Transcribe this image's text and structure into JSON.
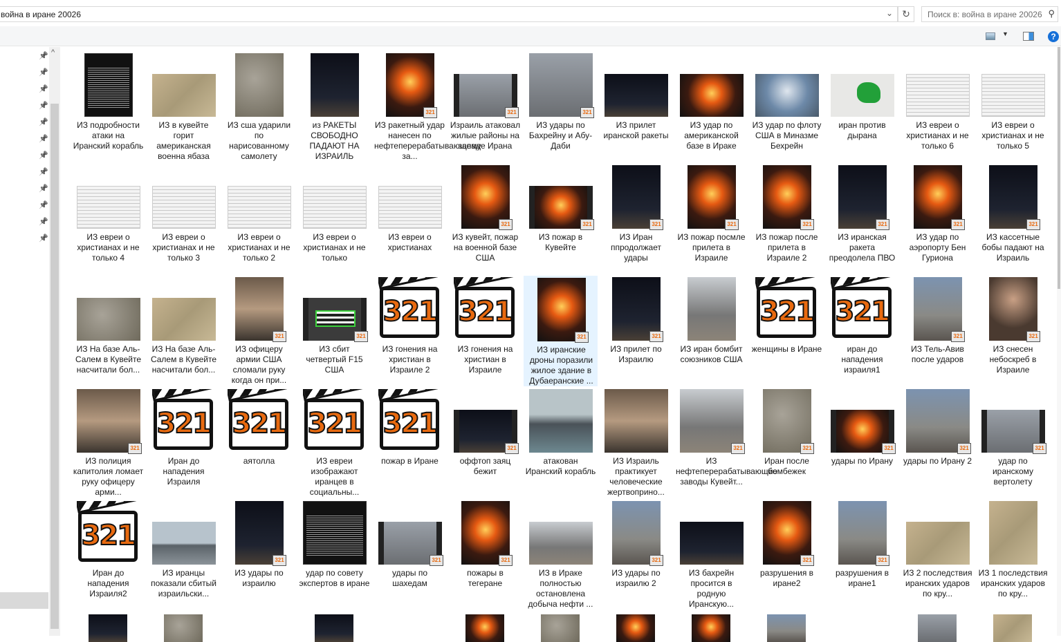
{
  "address": {
    "path": "война в иране 20026",
    "search_placeholder": "Поиск в: война в иране 20026"
  },
  "toolbar": {
    "view_icon": "change-view-icon",
    "dropdown": "▼",
    "preview_pane_icon": "preview-pane-icon",
    "help": "?"
  },
  "colors": {
    "selection": "#e5f3ff",
    "accent": "#1670d8",
    "badge": "#e86a10"
  },
  "badge_text": "321",
  "items": [
    {
      "label": "ИЗ подробности атаки на Иранский корабль",
      "thumb": "tweet",
      "shape": "portrait"
    },
    {
      "label": "ИЗ в кувейте горит американская военна ябаза",
      "thumb": "map",
      "shape": "land"
    },
    {
      "label": "ИЗ сша ударили по нарисованному самолету",
      "thumb": "tan",
      "shape": "portrait"
    },
    {
      "label": "из РАКЕТЫ СВОБОДНО ПАДАЮТ НА ИЗРАИЛЬ",
      "thumb": "dark",
      "shape": "portrait"
    },
    {
      "label": "ИЗ ракетный удар нанесен по нефтеперерабатывающему за...",
      "thumb": "fire",
      "shape": "portrait",
      "badge": true
    },
    {
      "label": "Израиль атаковал жилые районы на западе Ирана",
      "thumb": "gray",
      "shape": "film",
      "badge": true
    },
    {
      "label": "ИЗ удары по Бахрейну и Абу-Даби",
      "thumb": "gray",
      "shape": "vlcsz",
      "badge": true
    },
    {
      "label": "ИЗ прилет иранской ракеты",
      "thumb": "dark",
      "shape": "land"
    },
    {
      "label": "ИЗ удар по американской базе в Ираке",
      "thumb": "fire",
      "shape": "land"
    },
    {
      "label": "ИЗ удар по флоту США в Миназме Бехрейн",
      "thumb": "blue",
      "shape": "land"
    },
    {
      "label": "иран против дырана",
      "thumb": "iran",
      "shape": "land"
    },
    {
      "label": "ИЗ евреи о христианах и не только 6",
      "thumb": "doc",
      "shape": "land"
    },
    {
      "label": "ИЗ евреи о христианах и не только 5",
      "thumb": "doc",
      "shape": "land"
    },
    {
      "label": "ИЗ евреи о христианах и не только 4",
      "thumb": "doc",
      "shape": "land"
    },
    {
      "label": "ИЗ евреи о христианах и не только 3",
      "thumb": "doc",
      "shape": "land"
    },
    {
      "label": "ИЗ евреи о христианах и не только 2",
      "thumb": "doc",
      "shape": "land"
    },
    {
      "label": "ИЗ евреи о христианах и не только",
      "thumb": "doc",
      "shape": "land"
    },
    {
      "label": "ИЗ евреи о христианах",
      "thumb": "doc",
      "shape": "land"
    },
    {
      "label": "ИЗ кувейт, пожар на военной базе США",
      "thumb": "fire",
      "shape": "portrait",
      "badge": true
    },
    {
      "label": "ИЗ пожар в Кувейте",
      "thumb": "fire",
      "shape": "film",
      "badge": true
    },
    {
      "label": "ИЗ Иран ппродолжает удары",
      "thumb": "dark",
      "shape": "portrait",
      "badge": true
    },
    {
      "label": "ИЗ пожар посмле прилета в Израиле",
      "thumb": "fire",
      "shape": "portrait",
      "badge": true
    },
    {
      "label": "ИЗ пожар после прилета в Израиле 2",
      "thumb": "fire",
      "shape": "portrait",
      "badge": true
    },
    {
      "label": "ИЗ иранская ракета преодолела ПВО",
      "thumb": "dark",
      "shape": "portrait",
      "badge": true
    },
    {
      "label": "ИЗ удар по аэропорту Бен Гуриона",
      "thumb": "fire",
      "shape": "portrait",
      "badge": true
    },
    {
      "label": "ИЗ кассетные бобы падают на Израиль",
      "thumb": "dark",
      "shape": "portrait",
      "badge": true
    },
    {
      "label": "ИЗ На базе Аль-Салем в Кувейте насчитали бол...",
      "thumb": "tan",
      "shape": "land"
    },
    {
      "label": "ИЗ На базе Аль-Салем в Кувейте насчитали бол...",
      "thumb": "map",
      "shape": "land"
    },
    {
      "label": "ИЗ офицеру армии США сломали руку когда он при...",
      "thumb": "people",
      "shape": "portrait",
      "badge": true
    },
    {
      "label": "ИЗ сбит четвертый F15 США",
      "thumb": "green",
      "shape": "film",
      "badge": true
    },
    {
      "label": "ИЗ гонения на христиан в Израиле 2",
      "thumb": "vlc",
      "shape": "vlc"
    },
    {
      "label": "ИЗ гонения на христиан в Израиле",
      "thumb": "vlc",
      "shape": "vlc"
    },
    {
      "label": "ИЗ иранские дроны поразили жилое здание в Дубаеранские ...",
      "thumb": "fire",
      "shape": "portrait",
      "badge": true,
      "selected": true
    },
    {
      "label": "ИЗ прилет по Израилю",
      "thumb": "dark",
      "shape": "portrait",
      "badge": true
    },
    {
      "label": "ИЗ иран бомбит союзников США",
      "thumb": "smoke",
      "shape": "portrait"
    },
    {
      "label": "женщины в Иране",
      "thumb": "vlc",
      "shape": "vlc"
    },
    {
      "label": "иран до нападения израиля1",
      "thumb": "vlc",
      "shape": "vlc"
    },
    {
      "label": "ИЗ Тель-Авив после ударов",
      "thumb": "city",
      "shape": "portrait",
      "badge": true
    },
    {
      "label": "ИЗ снесен небоскреб в Израиле",
      "thumb": "person",
      "shape": "portrait",
      "badge": true
    },
    {
      "label": "ИЗ полиция капитолия ломает руку офицеру арми...",
      "thumb": "people",
      "shape": "vlcsz",
      "badge": true
    },
    {
      "label": "Иран до нападения Израиля",
      "thumb": "vlc",
      "shape": "vlc"
    },
    {
      "label": "аятолла",
      "thumb": "vlc",
      "shape": "vlc"
    },
    {
      "label": "ИЗ евреи изображают иранцев в социальны...",
      "thumb": "vlc",
      "shape": "vlc"
    },
    {
      "label": "пожар в Иране",
      "thumb": "vlc",
      "shape": "vlc"
    },
    {
      "label": "оффтоп заяц бежит",
      "thumb": "dark",
      "shape": "film",
      "badge": true
    },
    {
      "label": "атакован Иранский корабль",
      "thumb": "sea",
      "shape": "vlcsz"
    },
    {
      "label": "ИЗ Израиль практикует человеческие жертвоприно...",
      "thumb": "people",
      "shape": "vlcsz"
    },
    {
      "label": "ИЗ нефтеперерабатывающие заводы Кувейт...",
      "thumb": "smoke",
      "shape": "vlcsz",
      "badge": true
    },
    {
      "label": "Иран после бомбежек",
      "thumb": "tan",
      "shape": "portrait",
      "badge": true
    },
    {
      "label": "удары по Ирану",
      "thumb": "fire",
      "shape": "film",
      "badge": true
    },
    {
      "label": "удары по Ирану 2",
      "thumb": "city",
      "shape": "vlcsz",
      "badge": true
    },
    {
      "label": "удар по иранскому вертолету",
      "thumb": "gray",
      "shape": "film",
      "badge": true
    },
    {
      "label": "Иран до нападения Израиля2",
      "thumb": "vlc",
      "shape": "vlc"
    },
    {
      "label": "ИЗ иранцы показали сбитый израильски...",
      "thumb": "plane",
      "shape": "land"
    },
    {
      "label": "ИЗ удары по израилю",
      "thumb": "dark",
      "shape": "portrait",
      "badge": true
    },
    {
      "label": "удар по совету экспертов в иране",
      "thumb": "tweet",
      "shape": "vlcsz"
    },
    {
      "label": "удары по шахедам",
      "thumb": "gray",
      "shape": "film",
      "badge": true
    },
    {
      "label": "пожары в тегеране",
      "thumb": "fire",
      "shape": "portrait",
      "badge": true
    },
    {
      "label": "ИЗ в Ираке полностью остановлена добыча нефти ...",
      "thumb": "smoke",
      "shape": "land"
    },
    {
      "label": "ИЗ удары по израилю 2",
      "thumb": "city",
      "shape": "portrait",
      "badge": true
    },
    {
      "label": "ИЗ бахрейн просится в родную Иранскую...",
      "thumb": "dark",
      "shape": "land"
    },
    {
      "label": "разрушения в иране2",
      "thumb": "fire",
      "shape": "portrait",
      "badge": true
    },
    {
      "label": "разрушения в иране1",
      "thumb": "city",
      "shape": "portrait",
      "badge": true
    },
    {
      "label": "ИЗ 2 последствия иранских ударов по кру...",
      "thumb": "map",
      "shape": "land"
    },
    {
      "label": "ИЗ 1 последствия иранских ударов по кру...",
      "thumb": "map",
      "shape": "portrait"
    }
  ]
}
